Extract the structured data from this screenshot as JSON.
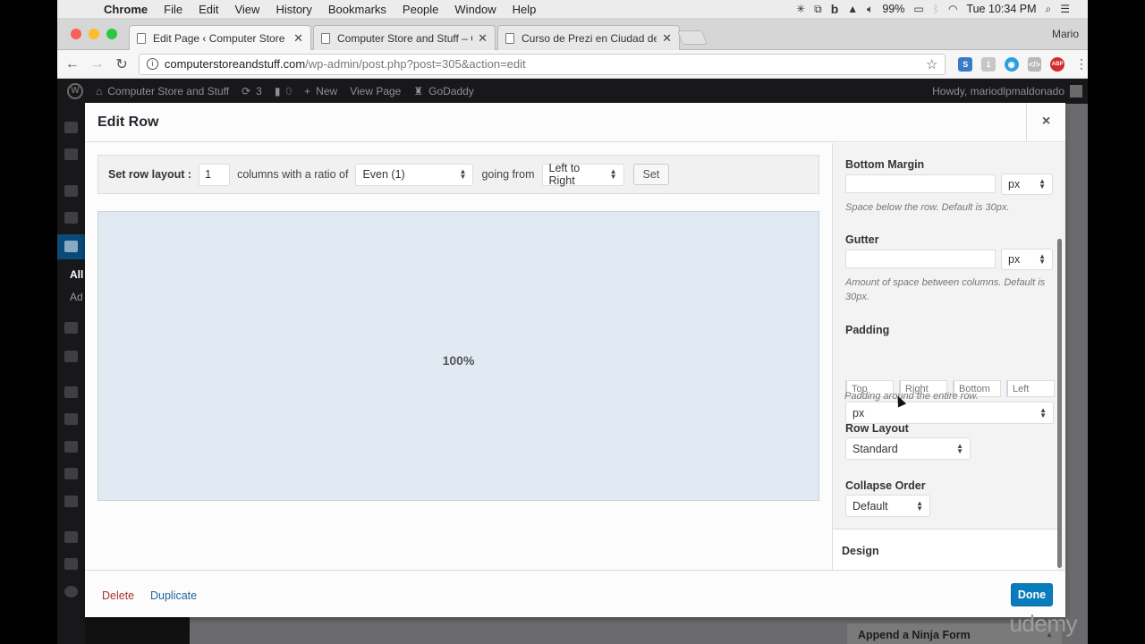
{
  "menubar": {
    "app": "Chrome",
    "items": [
      "File",
      "Edit",
      "View",
      "History",
      "Bookmarks",
      "People",
      "Window",
      "Help"
    ],
    "tray": {
      "icons": [
        "brightness-icon",
        "screen-record-icon",
        "b-icon",
        "drive-icon",
        "volume-icon"
      ],
      "battery": "99%",
      "clock": "Tue 10:34 PM"
    }
  },
  "browser": {
    "tabs": [
      {
        "title": "Edit Page ‹ Computer Store and Stuff",
        "active": true
      },
      {
        "title": "Computer Store and Stuff – Computer",
        "active": false
      },
      {
        "title": "Curso de Prezi en Ciudad de México",
        "active": false
      }
    ],
    "profile": "Mario",
    "url_host": "computerstoreandstuff.com",
    "url_path": "/wp-admin/post.php?post=305&action=edit",
    "extensions": [
      "S",
      "1",
      "◉",
      "</>",
      "ABP"
    ]
  },
  "adminbar": {
    "site_name": "Computer Store and Stuff",
    "updates": "3",
    "comments": "0",
    "new_label": "New",
    "view_page": "View Page",
    "godaddy": "GoDaddy",
    "howdy": "Howdy, mariodlpmaldonado"
  },
  "sidebar": {
    "submenu": [
      "All",
      "Ad"
    ]
  },
  "modal": {
    "title": "Edit Row",
    "close": "×",
    "layout_bar": {
      "label": "Set row layout :",
      "columns_value": "1",
      "ratio_text": "columns with a ratio of",
      "ratio_value": "Even (1)",
      "going_text": "going from",
      "direction_value": "Left to Right",
      "set_label": "Set"
    },
    "row_preview": {
      "column_width": "100%"
    },
    "settings": {
      "bottom_margin": {
        "label": "Bottom Margin",
        "value": "",
        "unit": "px",
        "help": "Space below the row. Default is 30px."
      },
      "gutter": {
        "label": "Gutter",
        "value": "",
        "unit": "px",
        "help": "Amount of space between columns. Default is 30px."
      },
      "padding": {
        "label": "Padding",
        "placeholders": {
          "top": "Top",
          "right": "Right",
          "bottom": "Bottom",
          "left": "Left"
        },
        "unit": "px",
        "help": "Padding around the entire row."
      },
      "row_layout": {
        "label": "Row Layout",
        "value": "Standard"
      },
      "collapse_order": {
        "label": "Collapse Order",
        "value": "Default"
      },
      "design_label": "Design"
    },
    "footer": {
      "delete": "Delete",
      "duplicate": "Duplicate",
      "done": "Done"
    }
  },
  "background": {
    "ninja_form": "Append a Ninja Form",
    "watermark": "udemy"
  },
  "colors": {
    "wp_blue": "#0a7cbd",
    "delete_red": "#aa3333",
    "link_blue": "#1c67a0",
    "preview_bg": "#e1eaf3"
  }
}
